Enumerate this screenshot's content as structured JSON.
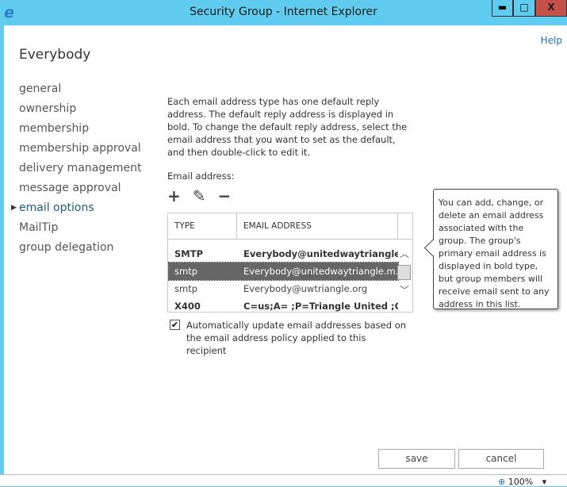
{
  "window": {
    "title": "Security Group - Internet Explorer",
    "minimize": "▬",
    "maximize": "□",
    "close": "X"
  },
  "help": "Help",
  "heading": "Everybody",
  "nav": [
    "general",
    "ownership",
    "membership",
    "membership approval",
    "delivery management",
    "message approval",
    "email options",
    "MailTip",
    "group delegation"
  ],
  "description": "Each email address type has one default reply address. The default reply address is displayed in bold. To change the default reply address, select the email address that you want to set as the default, and then double-click to edit it.",
  "email_label": "Email address:",
  "toolbar": {
    "add": "+",
    "edit": "✎",
    "remove": "−"
  },
  "grid": {
    "headers": [
      "TYPE",
      "EMAIL ADDRESS"
    ],
    "rows": [
      {
        "type": "SMTP",
        "address": "Everybody@unitedwaytriangle.o..."
      },
      {
        "type": "smtp",
        "address": "Everybody@unitedwaytriangle.m..."
      },
      {
        "type": "smtp",
        "address": "Everybody@uwtriangle.org"
      },
      {
        "type": "X400",
        "address": "C=us;A= ;P=Triangle United ;O=..."
      }
    ]
  },
  "auto_update": {
    "checked": true,
    "label": "Automatically update email addresses based on the email address policy applied to this recipient"
  },
  "tooltip": "You can add, change, or delete an email address associated with the group. The group's primary email address is displayed in bold type, but group members will receive email sent to any address in this list.",
  "buttons": {
    "save": "save",
    "cancel": "cancel"
  },
  "status": {
    "zoom": "100%"
  }
}
